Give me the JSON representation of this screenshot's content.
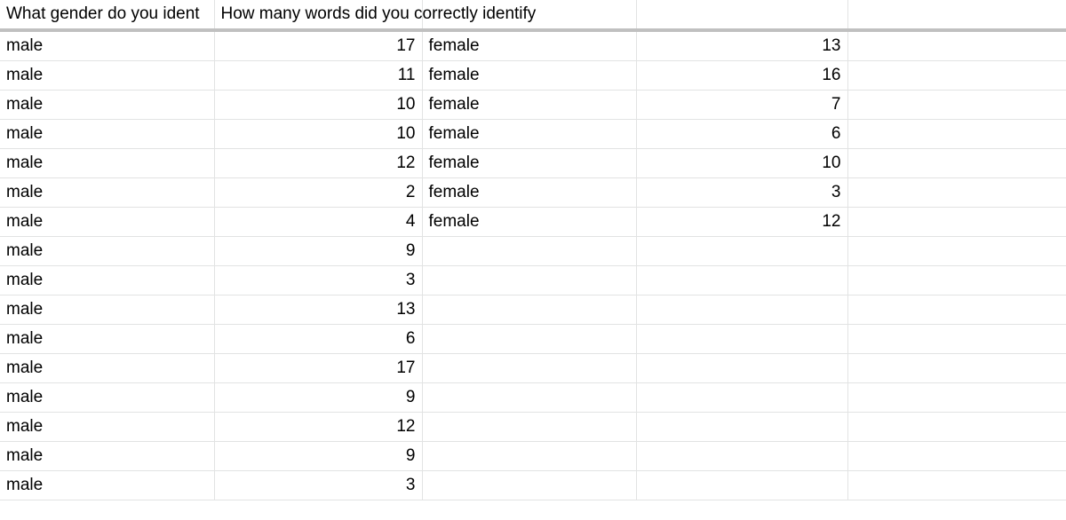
{
  "header": {
    "col_a": "What gender do you ident",
    "col_b": "How many words did you correctly identify",
    "col_c": "",
    "col_d": "",
    "col_e": ""
  },
  "columns": [
    "What gender do you ident",
    "How many words did you correctly identify",
    "",
    "",
    ""
  ],
  "rows": [
    {
      "gender": "male",
      "words": "17",
      "gender2": "female",
      "words2": "13"
    },
    {
      "gender": "male",
      "words": "11",
      "gender2": "female",
      "words2": "16"
    },
    {
      "gender": "male",
      "words": "10",
      "gender2": "female",
      "words2": "7"
    },
    {
      "gender": "male",
      "words": "10",
      "gender2": "female",
      "words2": "6"
    },
    {
      "gender": "male",
      "words": "12",
      "gender2": "female",
      "words2": "10"
    },
    {
      "gender": "male",
      "words": "2",
      "gender2": "female",
      "words2": "3"
    },
    {
      "gender": "male",
      "words": "4",
      "gender2": "female",
      "words2": "12"
    },
    {
      "gender": "male",
      "words": "9",
      "gender2": "",
      "words2": ""
    },
    {
      "gender": "male",
      "words": "3",
      "gender2": "",
      "words2": ""
    },
    {
      "gender": "male",
      "words": "13",
      "gender2": "",
      "words2": ""
    },
    {
      "gender": "male",
      "words": "6",
      "gender2": "",
      "words2": ""
    },
    {
      "gender": "male",
      "words": "17",
      "gender2": "",
      "words2": ""
    },
    {
      "gender": "male",
      "words": "9",
      "gender2": "",
      "words2": ""
    },
    {
      "gender": "male",
      "words": "12",
      "gender2": "",
      "words2": ""
    },
    {
      "gender": "male",
      "words": "9",
      "gender2": "",
      "words2": ""
    },
    {
      "gender": "male",
      "words": "3",
      "gender2": "",
      "words2": ""
    }
  ]
}
